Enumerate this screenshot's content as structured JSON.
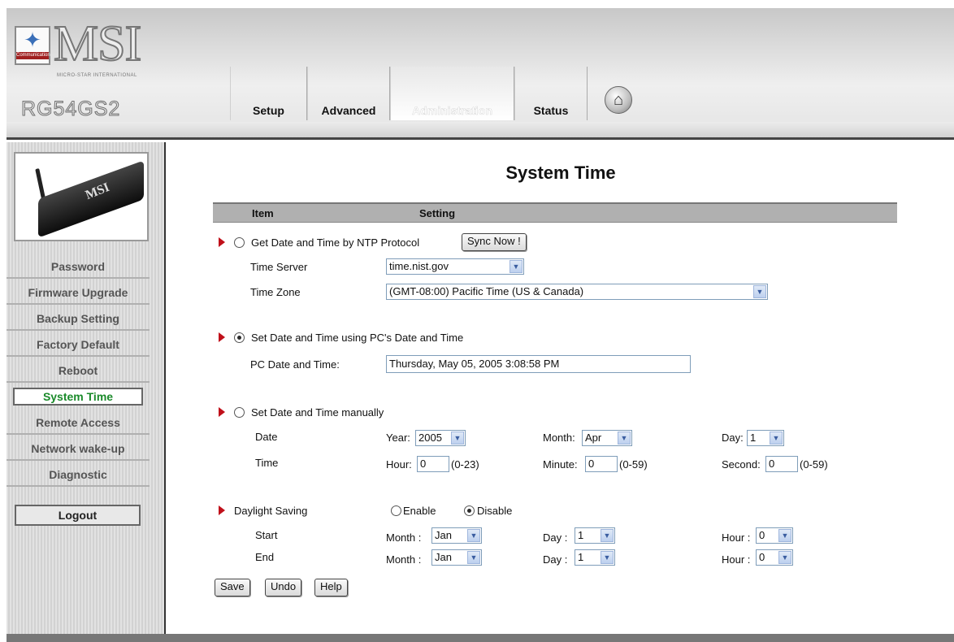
{
  "header": {
    "logo_small": "MSI",
    "logo_tag": "Communication",
    "brand": "MSI",
    "brand_sub": "MICRO-STAR INTERNATIONAL",
    "model": "RG54GS2",
    "tabs": [
      {
        "label": "Setup",
        "active": false
      },
      {
        "label": "Advanced",
        "active": false
      },
      {
        "label": "Administration",
        "active": true
      },
      {
        "label": "Status",
        "active": false
      }
    ],
    "home_icon": "home-icon"
  },
  "sidebar": {
    "router_label": "MSI",
    "items": [
      {
        "label": "Password",
        "active": false
      },
      {
        "label": "Firmware Upgrade",
        "active": false
      },
      {
        "label": "Backup Setting",
        "active": false
      },
      {
        "label": "Factory Default",
        "active": false
      },
      {
        "label": "Reboot",
        "active": false
      },
      {
        "label": "System Time",
        "active": true
      },
      {
        "label": "Remote Access",
        "active": false
      },
      {
        "label": "Network wake-up",
        "active": false
      },
      {
        "label": "Diagnostic",
        "active": false
      }
    ],
    "logout": "Logout"
  },
  "main": {
    "title": "System Time",
    "col_item": "Item",
    "col_setting": "Setting",
    "ntp": {
      "label": "Get Date and Time by NTP Protocol",
      "selected": false,
      "sync_button": "Sync Now !",
      "server_label": "Time Server",
      "server_value": "time.nist.gov",
      "zone_label": "Time Zone",
      "zone_value": "(GMT-08:00) Pacific Time (US & Canada)"
    },
    "pc": {
      "label": "Set Date and Time using PC's Date and Time",
      "selected": true,
      "field_label": "PC Date and Time:",
      "field_value": "Thursday, May 05, 2005 3:08:58 PM"
    },
    "manual": {
      "label": "Set Date and Time manually",
      "selected": false,
      "date_label": "Date",
      "time_label": "Time",
      "year_label": "Year:",
      "year_value": "2005",
      "month_label": "Month:",
      "month_value": "Apr",
      "day_label": "Day:",
      "day_value": "1",
      "hour_label": "Hour:",
      "hour_value": "0",
      "hour_range": "(0-23)",
      "minute_label": "Minute:",
      "minute_value": "0",
      "minute_range": "(0-59)",
      "second_label": "Second:",
      "second_value": "0",
      "second_range": "(0-59)"
    },
    "dst": {
      "label": "Daylight Saving",
      "enable_label": "Enable",
      "disable_label": "Disable",
      "enabled": false,
      "start_label": "Start",
      "end_label": "End",
      "month_label": "Month :",
      "day_label": "Day :",
      "hour_label": "Hour :",
      "start_month": "Jan",
      "start_day": "1",
      "start_hour": "0",
      "end_month": "Jan",
      "end_day": "1",
      "end_hour": "0"
    },
    "buttons": {
      "save": "Save",
      "undo": "Undo",
      "help": "Help"
    }
  }
}
